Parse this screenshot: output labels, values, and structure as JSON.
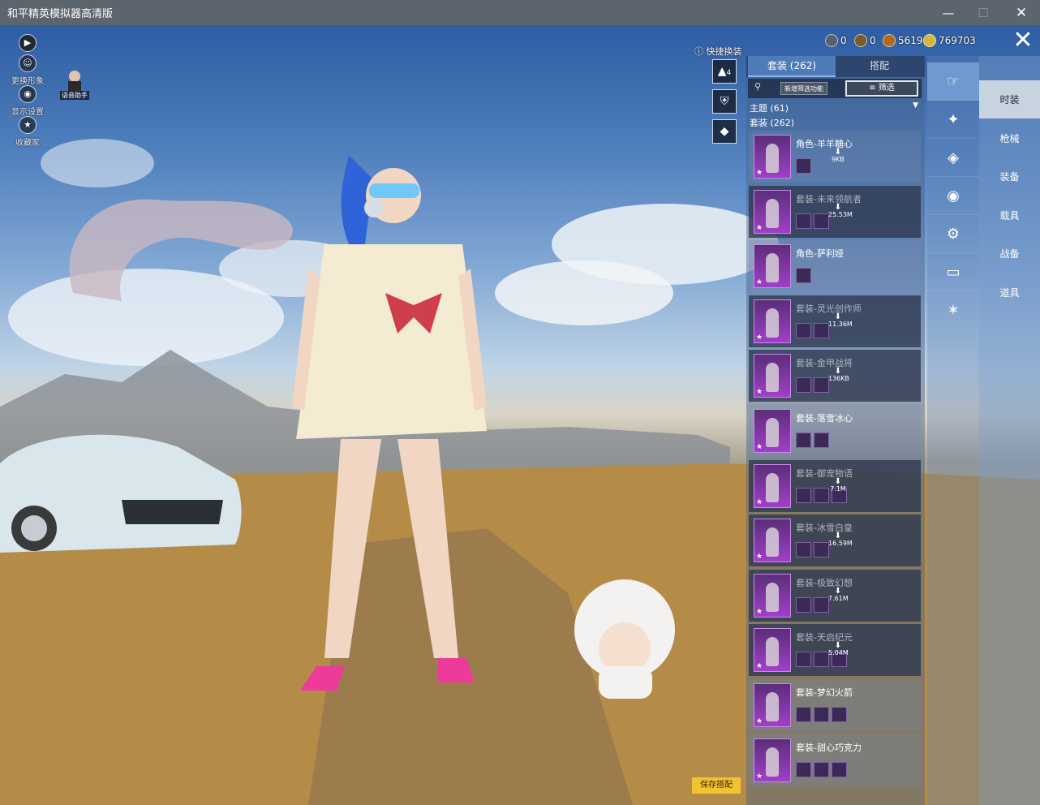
{
  "window": {
    "title": "和平精英模拟器高清版",
    "min_icon": "minimize-icon",
    "max_icon": "maximize-icon",
    "close_icon": "close-icon"
  },
  "left_tools": [
    {
      "label": "更换形象",
      "icon": "person-icon"
    },
    {
      "label": "显示设置",
      "icon": "eye-icon"
    },
    {
      "label": "收藏家",
      "icon": "badge-icon"
    }
  ],
  "avatar_helper_label": "语音助手",
  "currencies": [
    {
      "value": "0",
      "color": "#5a5f6b"
    },
    {
      "value": "0",
      "color": "#7a5a2a"
    },
    {
      "value": "5619",
      "color": "#b06a20"
    },
    {
      "value": "769703",
      "color": "#d4b83a"
    }
  ],
  "quick_change": {
    "label": "快捷换装",
    "icon": "help-icon",
    "slot_number": "4"
  },
  "panel": {
    "tabs": [
      "套装 (262)",
      "搭配"
    ],
    "new_filter_label": "新增筛选功能",
    "filter_label": "筛选",
    "theme_label": "主题 (61)",
    "suit_count_label": "套装 (262)"
  },
  "items": [
    {
      "name": "角色-羊羊糖心",
      "owned": true,
      "size": "9KB",
      "download": true,
      "subs": 1
    },
    {
      "name": "套装-未来领航者",
      "owned": false,
      "size": "25.53M",
      "download": true,
      "subs": 2
    },
    {
      "name": "角色-萨利娅",
      "owned": true,
      "size": "",
      "download": false,
      "subs": 1
    },
    {
      "name": "套装-灵光创作师",
      "owned": false,
      "size": "11.36M",
      "download": true,
      "subs": 2
    },
    {
      "name": "套装-金甲战将",
      "owned": false,
      "size": "136KB",
      "download": true,
      "subs": 2
    },
    {
      "name": "套装-落雪冰心",
      "owned": true,
      "size": "",
      "download": false,
      "subs": 2
    },
    {
      "name": "套装-御宠物语",
      "owned": false,
      "size": "7.1M",
      "download": true,
      "subs": 3
    },
    {
      "name": "套装-冰雪白皇",
      "owned": false,
      "size": "16.59M",
      "download": true,
      "subs": 2
    },
    {
      "name": "套装-极致幻想",
      "owned": false,
      "size": "7.61M",
      "download": true,
      "subs": 2
    },
    {
      "name": "套装-天启纪元",
      "owned": false,
      "size": "5.04M",
      "download": true,
      "subs": 3
    },
    {
      "name": "套装-梦幻火箭",
      "owned": true,
      "size": "",
      "download": false,
      "subs": 3
    },
    {
      "name": "套装-甜心巧克力",
      "owned": true,
      "size": "",
      "download": false,
      "subs": 3
    }
  ],
  "categories": [
    "outfit-icon",
    "weapon-icon",
    "gear-icon",
    "mask-icon",
    "vehicle-icon",
    "pants-icon",
    "emote-icon"
  ],
  "menu": [
    "时装",
    "枪械",
    "装备",
    "载具",
    "战备",
    "道具"
  ],
  "save_label": "保存搭配"
}
